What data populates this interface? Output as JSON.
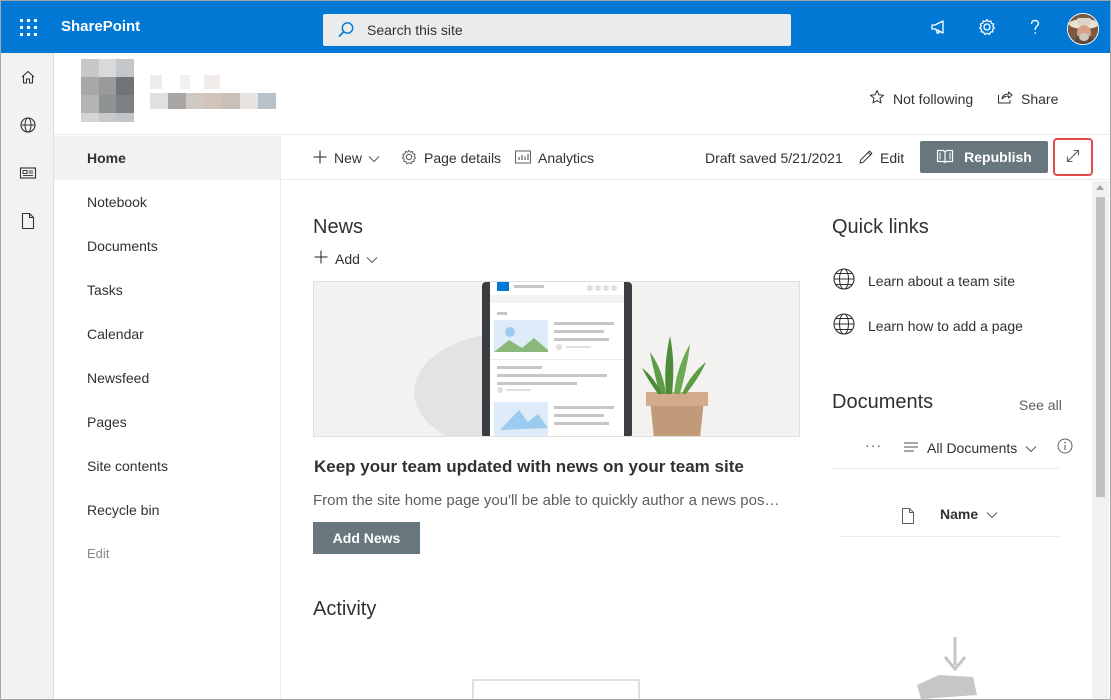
{
  "suitebar": {
    "app_name": "SharePoint",
    "search_placeholder": "Search this site"
  },
  "site_header": {
    "follow_label": "Not following",
    "share_label": "Share"
  },
  "leftnav": {
    "items": [
      {
        "label": "Home",
        "active": true
      },
      {
        "label": "Notebook"
      },
      {
        "label": "Documents"
      },
      {
        "label": "Tasks"
      },
      {
        "label": "Calendar"
      },
      {
        "label": "Newsfeed"
      },
      {
        "label": "Pages"
      },
      {
        "label": "Site contents"
      },
      {
        "label": "Recycle bin"
      }
    ],
    "edit_label": "Edit"
  },
  "commandbar": {
    "new_label": "New",
    "page_details_label": "Page details",
    "analytics_label": "Analytics",
    "draft_status": "Draft saved 5/21/2021",
    "edit_label": "Edit",
    "republish_label": "Republish"
  },
  "news": {
    "title": "News",
    "add_label": "Add",
    "heading": "Keep your team updated with news on your team site",
    "description": "From the site home page you'll be able to quickly author a news post - a status update, trip report, or planning document.",
    "add_news_label": "Add News"
  },
  "activity": {
    "title": "Activity"
  },
  "quick_links": {
    "title": "Quick links",
    "items": [
      {
        "label": "Learn about a team site"
      },
      {
        "label": "Learn how to add a page"
      }
    ]
  },
  "documents": {
    "title": "Documents",
    "see_all_label": "See all",
    "more_label": "···",
    "view_label": "All Documents",
    "column_name": "Name"
  },
  "colors": {
    "suitebar": "#0078d4",
    "button_gray": "#68777d",
    "highlight_border": "#e34c4c"
  }
}
